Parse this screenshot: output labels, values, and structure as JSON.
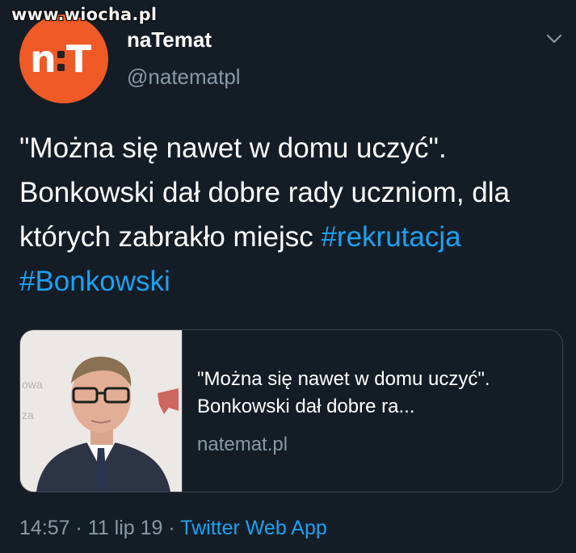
{
  "watermark": "www.wiocha.pl",
  "author": {
    "display_name": "naTemat",
    "handle": "@natematpl",
    "avatar_letters_left": "n",
    "avatar_letters_right": "T"
  },
  "tweet": {
    "text_plain": "\"Można się nawet w domu uczyć\". Bonkowski dał dobre rady uczniom, dla których zabrakło miejsc ",
    "hashtags": [
      "#rekrutacja",
      "#Bonkowski"
    ]
  },
  "card": {
    "title": "\"Można się nawet w domu uczyć\". Bonkowski dał dobre ra...",
    "domain": "natemat.pl",
    "image_bg_text_1": "owa",
    "image_bg_text_2": "za"
  },
  "meta": {
    "time": "14:57",
    "sep1": " · ",
    "date": "11 lip 19",
    "sep2": " · ",
    "source": "Twitter Web App"
  },
  "icons": {
    "chevron": "chevron-down-icon"
  },
  "colors": {
    "background": "#141d26",
    "accent": "#1da1f2",
    "secondary_text": "#8899a6",
    "avatar": "#ef5a26"
  }
}
